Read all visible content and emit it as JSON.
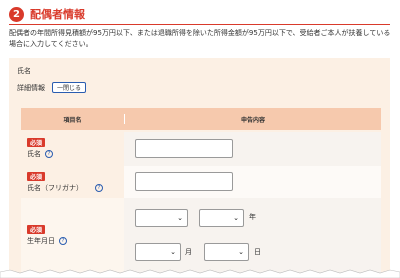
{
  "section": {
    "step_number": "2",
    "title": "配偶者情報",
    "description": "配偶者の年間所得見積額が95万円以下、または退職所得を除いた所得金額が95万円以下で、受給者ご本人が扶養している場合に入力してください。"
  },
  "panel": {
    "name_label": "氏名",
    "detail_label": "詳細情報",
    "close_button": "一閉じる"
  },
  "table": {
    "col_item": "項目名",
    "col_content": "申告内容",
    "required_badge": "必須",
    "help_glyph": "?",
    "rows": [
      {
        "label": "氏名"
      },
      {
        "label": "氏名（フリガナ）"
      },
      {
        "label": "生年月日"
      }
    ],
    "units": {
      "year": "年",
      "month": "月",
      "day": "日"
    },
    "select_chevron": "⌄"
  },
  "colors": {
    "accent": "#d93a2b",
    "panel_bg": "#fcf0e4",
    "header_bg": "#f6c9ad",
    "link_blue": "#2a5db0"
  }
}
